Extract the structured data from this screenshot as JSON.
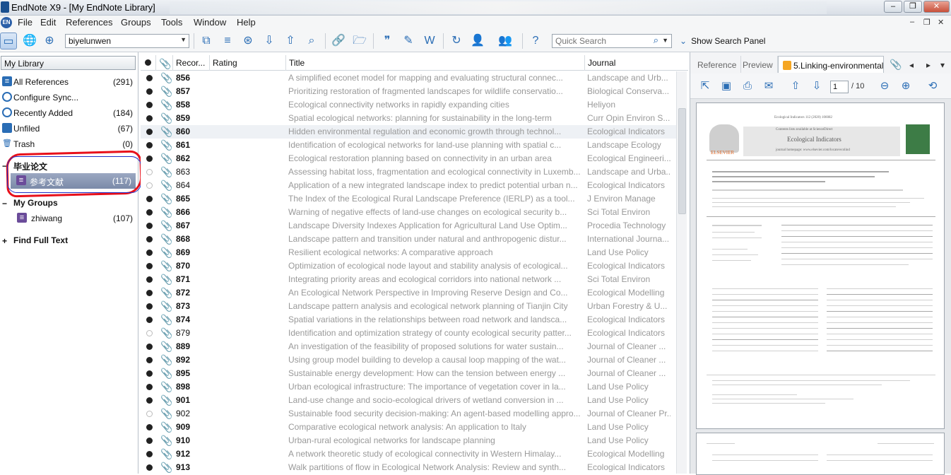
{
  "window": {
    "title": "EndNote X9 - [My EndNote Library]",
    "controls": {
      "minimize": "–",
      "restore": "❐",
      "close": "✕"
    }
  },
  "menu": {
    "app_logo": "EN",
    "items": [
      "File",
      "Edit",
      "References",
      "Groups",
      "Tools",
      "Window",
      "Help"
    ],
    "mdi_controls": [
      "–",
      "❐",
      "✕"
    ]
  },
  "toolbar": {
    "group_select_value": "biyelunwen",
    "quick_search_placeholder": "Quick Search",
    "show_search_panel": "Show Search Panel",
    "help_glyph": "?"
  },
  "library": {
    "header": "My Library",
    "items": [
      {
        "label": "All References",
        "count": "(291)",
        "icon": "all-references-icon"
      },
      {
        "label": "Configure Sync...",
        "count": "",
        "icon": "sync-icon"
      },
      {
        "label": "Recently Added",
        "count": "(184)",
        "icon": "clock-icon"
      },
      {
        "label": "Unfiled",
        "count": "(67)",
        "icon": "unfiled-icon"
      },
      {
        "label": "Trash",
        "count": "(0)",
        "icon": "trash-icon"
      }
    ],
    "group_set": {
      "label": "毕业论文",
      "toggle": "−"
    },
    "selected_group": {
      "label": "参考文献",
      "count": "(117)"
    },
    "my_groups": {
      "label": "My Groups",
      "toggle": "−"
    },
    "zhiwang": {
      "label": "zhiwang",
      "count": "(107)"
    },
    "find_full_text": {
      "label": "Find Full Text",
      "toggle": "+"
    }
  },
  "columns": {
    "record": "Recor...",
    "rating": "Rating",
    "title": "Title",
    "journal": "Journal"
  },
  "references": [
    {
      "rec": "856",
      "read": false,
      "title": "A simplified econet model for mapping and evaluating structural connec...",
      "journal": "Landscape and Urb..."
    },
    {
      "rec": "857",
      "read": false,
      "title": "Prioritizing restoration of fragmented landscapes for wildlife conservatio...",
      "journal": "Biological Conserva..."
    },
    {
      "rec": "858",
      "read": false,
      "title": "Ecological connectivity networks in rapidly expanding cities",
      "journal": "Heliyon"
    },
    {
      "rec": "859",
      "read": false,
      "title": "Spatial ecological networks: planning for sustainability in the long-term",
      "journal": "Curr Opin Environ S..."
    },
    {
      "rec": "860",
      "read": false,
      "title": "Hidden environmental regulation and economic growth through technol...",
      "journal": "Ecological Indicators"
    },
    {
      "rec": "861",
      "read": false,
      "title": "Identification of ecological networks for land-use planning with spatial c...",
      "journal": "Landscape Ecology"
    },
    {
      "rec": "862",
      "read": false,
      "title": "Ecological restoration planning based on connectivity in an urban area",
      "journal": "Ecological Engineeri..."
    },
    {
      "rec": "863",
      "read": true,
      "title": "Assessing habitat loss, fragmentation and ecological connectivity in Luxemb...",
      "journal": "Landscape and Urba..."
    },
    {
      "rec": "864",
      "read": true,
      "title": "Application of a new integrated landscape index to predict potential urban n...",
      "journal": "Ecological Indicators"
    },
    {
      "rec": "865",
      "read": false,
      "title": "The Index of the Ecological Rural Landscape Preference (IERLP) as a tool...",
      "journal": "J Environ Manage"
    },
    {
      "rec": "866",
      "read": false,
      "title": "Warning of negative effects of land-use changes on ecological security b...",
      "journal": "Sci Total Environ"
    },
    {
      "rec": "867",
      "read": false,
      "title": "Landscape Diversity Indexes Application for Agricultural Land Use Optim...",
      "journal": "Procedia Technology"
    },
    {
      "rec": "868",
      "read": false,
      "title": "Landscape pattern and transition under natural and anthropogenic distur...",
      "journal": "International Journa..."
    },
    {
      "rec": "869",
      "read": false,
      "title": "Resilient ecological networks: A comparative approach",
      "journal": "Land Use Policy"
    },
    {
      "rec": "870",
      "read": false,
      "title": "Optimization of ecological node layout and stability analysis of ecological...",
      "journal": "Ecological Indicators"
    },
    {
      "rec": "871",
      "read": false,
      "title": "Integrating priority areas and ecological corridors into national network ...",
      "journal": "Sci Total Environ"
    },
    {
      "rec": "872",
      "read": false,
      "title": "An Ecological Network Perspective in Improving Reserve Design and Co...",
      "journal": "Ecological Modelling"
    },
    {
      "rec": "873",
      "read": false,
      "title": "Landscape pattern analysis and ecological network planning of Tianjin City",
      "journal": "Urban Forestry & U..."
    },
    {
      "rec": "874",
      "read": false,
      "title": "Spatial variations in the relationships between road network and landsca...",
      "journal": "Ecological Indicators"
    },
    {
      "rec": "879",
      "read": true,
      "title": "Identification and optimization strategy of county ecological security patter...",
      "journal": "Ecological Indicators"
    },
    {
      "rec": "889",
      "read": false,
      "title": "An investigation of the feasibility of proposed solutions for water sustain...",
      "journal": "Journal of Cleaner ..."
    },
    {
      "rec": "892",
      "read": false,
      "title": "Using group model building to develop a causal loop mapping of the wat...",
      "journal": "Journal of Cleaner ..."
    },
    {
      "rec": "895",
      "read": false,
      "title": "Sustainable energy development: How can the tension between energy ...",
      "journal": "Journal of Cleaner ..."
    },
    {
      "rec": "898",
      "read": false,
      "title": "Urban ecological infrastructure: The importance of vegetation cover in la...",
      "journal": "Land Use Policy"
    },
    {
      "rec": "901",
      "read": false,
      "title": "Land-use change and socio-ecological drivers of wetland conversion in ...",
      "journal": "Land Use Policy"
    },
    {
      "rec": "902",
      "read": true,
      "title": "Sustainable food security decision-making: An agent-based modelling appro...",
      "journal": "Journal of Cleaner Pr..."
    },
    {
      "rec": "909",
      "read": false,
      "title": "Comparative ecological network analysis: An application to Italy",
      "journal": "Land Use Policy"
    },
    {
      "rec": "910",
      "read": false,
      "title": "Urban-rural ecological networks for landscape planning",
      "journal": "Land Use Policy"
    },
    {
      "rec": "912",
      "read": false,
      "title": "A network theoretic study of ecological connectivity in Western Himalay...",
      "journal": "Ecological Modelling"
    },
    {
      "rec": "913",
      "read": false,
      "title": "Walk partitions of flow in Ecological Network Analysis: Review and synth...",
      "journal": "Ecological Indicators"
    }
  ],
  "preview": {
    "tabs": {
      "reference": "Reference",
      "preview": "Preview",
      "pdf": "5.Linking-environmental-"
    },
    "page_current": "1",
    "page_total": "/ 10",
    "pdf_header_line": "Ecological Indicators 112 (2020) 106082",
    "pdf_contents_line": "Contents lists available at ScienceDirect",
    "pdf_journal_name": "Ecological Indicators",
    "pdf_homepage": "journal homepage: www.elsevier.com/locate/ecolind",
    "pdf_publisher": "ELSEVIER"
  }
}
